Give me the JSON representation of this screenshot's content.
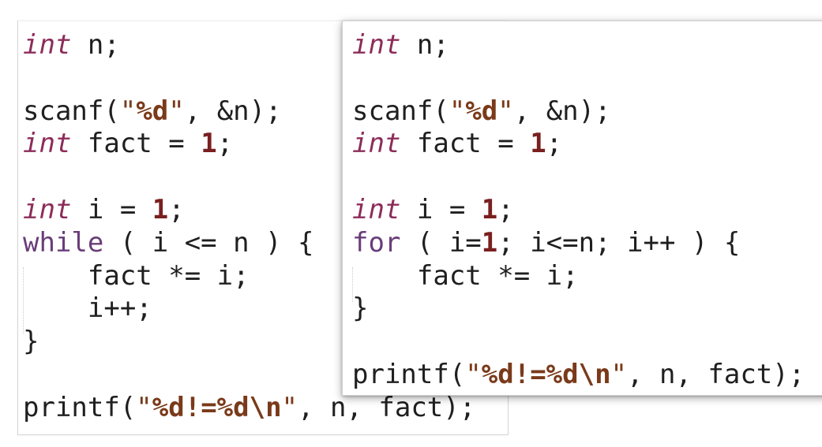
{
  "left_snippet": {
    "lines": [
      [
        {
          "t": "int",
          "c": "kw-type"
        },
        {
          "t": " n;",
          "c": "plain"
        }
      ],
      [],
      [
        {
          "t": "scanf(",
          "c": "plain"
        },
        {
          "t": "\"",
          "c": "str"
        },
        {
          "t": "%d",
          "c": "esc"
        },
        {
          "t": "\"",
          "c": "str"
        },
        {
          "t": ", &n);",
          "c": "plain"
        }
      ],
      [
        {
          "t": "int",
          "c": "kw-type"
        },
        {
          "t": " fact = ",
          "c": "plain"
        },
        {
          "t": "1",
          "c": "num"
        },
        {
          "t": ";",
          "c": "plain"
        }
      ],
      [],
      [
        {
          "t": "int",
          "c": "kw-type"
        },
        {
          "t": " i = ",
          "c": "plain"
        },
        {
          "t": "1",
          "c": "num"
        },
        {
          "t": ";",
          "c": "plain"
        }
      ],
      [
        {
          "t": "while",
          "c": "kw-ctl"
        },
        {
          "t": " ( i <= n ) {",
          "c": "plain"
        }
      ],
      [
        {
          "t": "    fact *= i;",
          "c": "plain"
        }
      ],
      [
        {
          "t": "    i++;",
          "c": "plain"
        }
      ],
      [
        {
          "t": "}",
          "c": "plain"
        }
      ],
      [],
      [
        {
          "t": "printf(",
          "c": "plain"
        },
        {
          "t": "\"",
          "c": "str"
        },
        {
          "t": "%d!=%d\\n",
          "c": "esc"
        },
        {
          "t": "\"",
          "c": "str"
        },
        {
          "t": ", n, fact);",
          "c": "plain"
        }
      ]
    ]
  },
  "right_snippet": {
    "lines": [
      [
        {
          "t": "int",
          "c": "kw-type"
        },
        {
          "t": " n;",
          "c": "plain"
        }
      ],
      [],
      [
        {
          "t": "scanf(",
          "c": "plain"
        },
        {
          "t": "\"",
          "c": "str"
        },
        {
          "t": "%d",
          "c": "esc"
        },
        {
          "t": "\"",
          "c": "str"
        },
        {
          "t": ", &n);",
          "c": "plain"
        }
      ],
      [
        {
          "t": "int",
          "c": "kw-type"
        },
        {
          "t": " fact = ",
          "c": "plain"
        },
        {
          "t": "1",
          "c": "num"
        },
        {
          "t": ";",
          "c": "plain"
        }
      ],
      [],
      [
        {
          "t": "int",
          "c": "kw-type"
        },
        {
          "t": " i = ",
          "c": "plain"
        },
        {
          "t": "1",
          "c": "num"
        },
        {
          "t": ";",
          "c": "plain"
        }
      ],
      [
        {
          "t": "for",
          "c": "kw-ctl"
        },
        {
          "t": " ( i=",
          "c": "plain"
        },
        {
          "t": "1",
          "c": "num"
        },
        {
          "t": "; i<=n; i++ ) {",
          "c": "plain"
        }
      ],
      [
        {
          "t": "    fact *= i;",
          "c": "plain"
        }
      ],
      [
        {
          "t": "}",
          "c": "plain"
        }
      ],
      [],
      [
        {
          "t": "printf(",
          "c": "plain"
        },
        {
          "t": "\"",
          "c": "str"
        },
        {
          "t": "%d!=%d\\n",
          "c": "esc"
        },
        {
          "t": "\"",
          "c": "str"
        },
        {
          "t": ", n, fact);",
          "c": "plain"
        }
      ]
    ]
  },
  "colors": {
    "type_keyword": "#8c2c5a",
    "control_keyword": "#6a3d7a",
    "string": "#7a3a1a",
    "number": "#7a1f1f",
    "text": "#1f1f1f",
    "background": "#ffffff"
  }
}
